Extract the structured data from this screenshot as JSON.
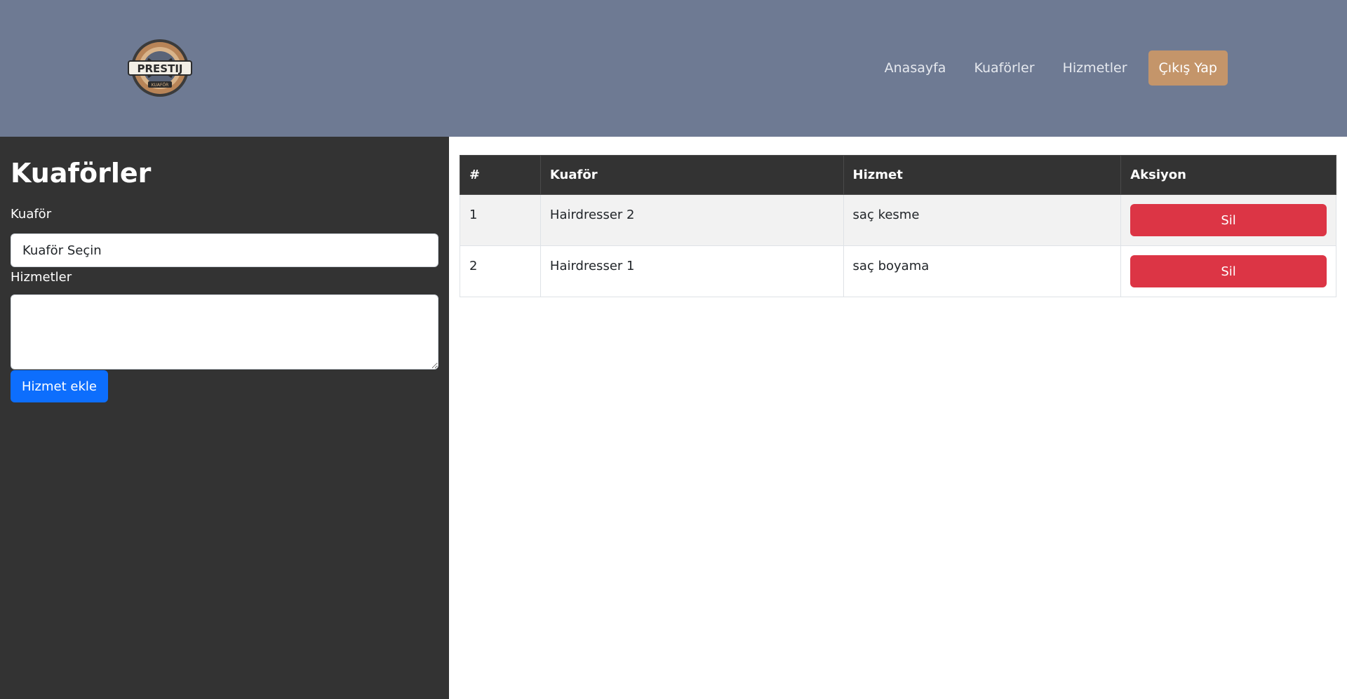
{
  "header": {
    "logo_text": "PRESTIJ",
    "logo_subtext": "KUAFÖR",
    "nav": [
      {
        "label": "Anasayfa"
      },
      {
        "label": "Kuaförler"
      },
      {
        "label": "Hizmetler"
      }
    ],
    "logout_label": "Çıkış Yap"
  },
  "sidebar": {
    "title": "Kuaförler",
    "hairdresser_label": "Kuaför",
    "hairdresser_select_value": "Kuaför Seçin",
    "services_label": "Hizmetler",
    "services_value": "",
    "add_button_label": "Hizmet ekle"
  },
  "table": {
    "headers": [
      "#",
      "Kuaför",
      "Hizmet",
      "Aksiyon"
    ],
    "rows": [
      {
        "index": "1",
        "hairdresser": "Hairdresser 2",
        "service": "saç kesme",
        "action": "Sil"
      },
      {
        "index": "2",
        "hairdresser": "Hairdresser 1",
        "service": "saç boyama",
        "action": "Sil"
      }
    ]
  },
  "colors": {
    "header_bg": "#6e7a93",
    "sidebar_bg": "#333333",
    "logout_btn": "#c4956a",
    "primary_btn": "#0d6efd",
    "danger_btn": "#dc3545"
  }
}
